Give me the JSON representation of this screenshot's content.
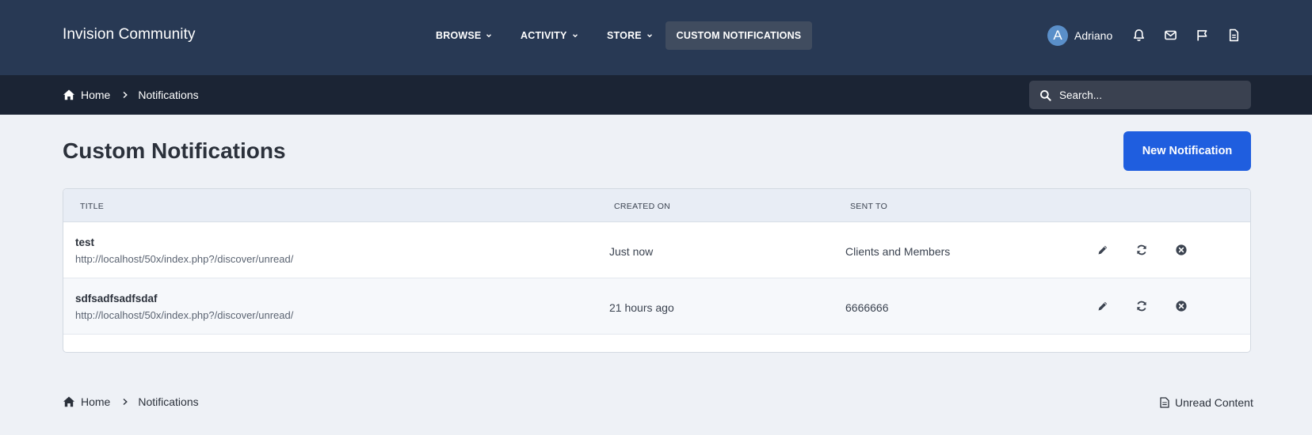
{
  "header": {
    "brand": "Invision Community",
    "nav": [
      {
        "label": "BROWSE",
        "has_dropdown": true
      },
      {
        "label": "ACTIVITY",
        "has_dropdown": true
      },
      {
        "label": "STORE",
        "has_dropdown": true
      },
      {
        "label": "CUSTOM NOTIFICATIONS",
        "has_dropdown": false,
        "active": true
      }
    ],
    "user": {
      "initial": "A",
      "name": "Adriano"
    },
    "icons": [
      "bell-icon",
      "envelope-icon",
      "flag-icon",
      "document-icon"
    ]
  },
  "breadcrumb": {
    "home": "Home",
    "current": "Notifications"
  },
  "search": {
    "placeholder": "Search..."
  },
  "page": {
    "title": "Custom Notifications",
    "new_button": "New Notification"
  },
  "table": {
    "columns": [
      "TITLE",
      "CREATED ON",
      "SENT TO"
    ],
    "rows": [
      {
        "title": "test",
        "url": "http://localhost/50x/index.php?/discover/unread/",
        "created": "Just now",
        "sent_to": "Clients and Members"
      },
      {
        "title": "sdfsadfsadfsdaf",
        "url": "http://localhost/50x/index.php?/discover/unread/",
        "created": "21 hours ago",
        "sent_to": "6666666"
      }
    ],
    "row_actions": [
      "edit-icon",
      "refresh-icon",
      "delete-icon"
    ]
  },
  "footer": {
    "breadcrumb_home": "Home",
    "breadcrumb_current": "Notifications",
    "unread_link": "Unread Content"
  },
  "colors": {
    "header_bg": "#283954",
    "breadcrumb_bg": "#1b2434",
    "page_bg": "#eef1f6",
    "primary_button": "#1f5edf",
    "active_nav_bg": "#404c5f"
  }
}
